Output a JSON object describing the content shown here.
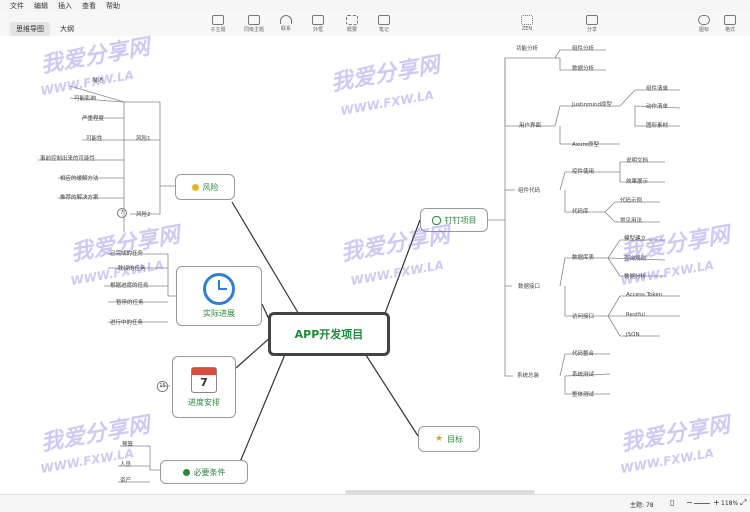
{
  "menu": [
    "文件",
    "编辑",
    "插入",
    "查看",
    "帮助"
  ],
  "tabs": [
    "思维导图",
    "大纲"
  ],
  "toolbar": [
    "子主题",
    "同级主题",
    "联系",
    "外框",
    "概要",
    "笔记"
  ],
  "right_toolbar": [
    "ZEN",
    "分享",
    "图标",
    "格式"
  ],
  "central": "APP开发项目",
  "branches": {
    "risk": "风险",
    "progress": "实际进展",
    "schedule": "进度安排",
    "conditions": "必要条件",
    "nail": "钉钉项目",
    "goal": "目标"
  },
  "risk": {
    "risk1": "风险1",
    "risk2": "风险2",
    "items": [
      "描述",
      "可能影响",
      "严重程度",
      "可能性",
      "事前控制出来的可能性",
      "相应的缓解方法",
      "推荐的解决方案"
    ],
    "badge": "7"
  },
  "progress_items": [
    "已完成的任务",
    "耽误的任务",
    "根据进度的任务",
    "暂停的任务",
    "进行中的任务"
  ],
  "schedule": {
    "badge": "15",
    "day": "7"
  },
  "conditions_items": [
    "预算",
    "人员",
    "资产"
  ],
  "nail": {
    "func": "功能分析",
    "func_items": [
      "组件分析",
      "数据分析"
    ],
    "ui": "用户界面",
    "ui_js": "Justinmind原型",
    "ui_js_items": [
      "组件清单",
      "动作清单",
      "图形素材"
    ],
    "ui_axure": "Axure原型",
    "comp": "组件代码",
    "comp_use": "控件使用",
    "comp_use_items": [
      "说明文档",
      "效果展示"
    ],
    "comp_lib": "代码库",
    "comp_lib_items": [
      "代码示例",
      "常见用法"
    ],
    "data": "数据接口",
    "db": "数据库表",
    "db_items": [
      "模型建立",
      "查询规则",
      "数据分析"
    ],
    "api": "访问接口",
    "api_items": [
      "Access Token",
      "Restful",
      "JSON"
    ],
    "sys": "系统总装",
    "sys_items": [
      "代码整合",
      "系统测试",
      "整体测试"
    ]
  },
  "status": {
    "topics": "主题: 78",
    "zoom": "118%"
  },
  "watermark": {
    "cn": "我爱分享网",
    "en": "WWW.FXW.LA"
  }
}
